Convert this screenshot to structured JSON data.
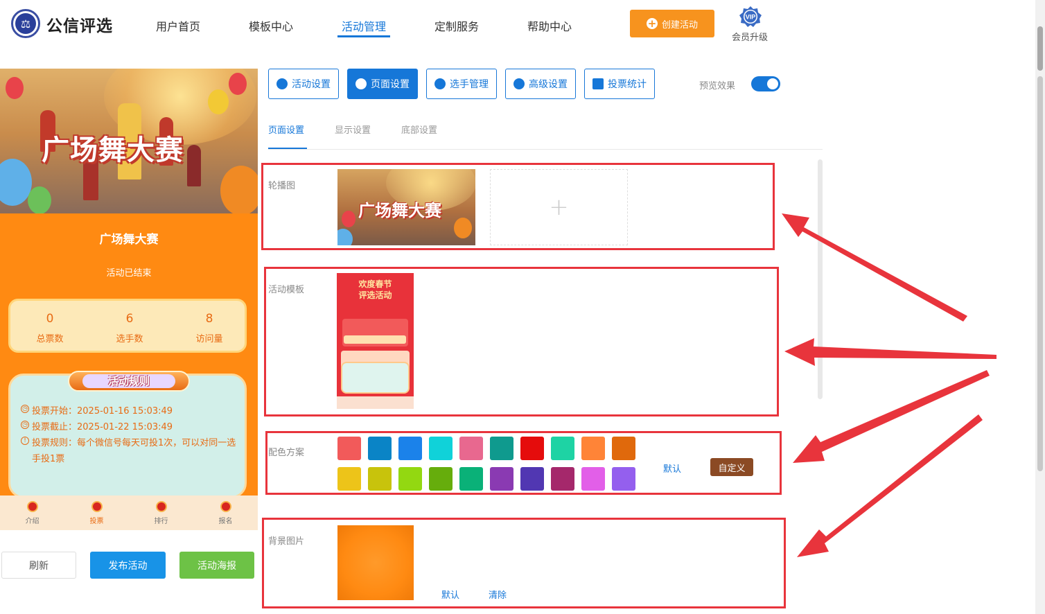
{
  "header": {
    "logo_text": "公信评选",
    "nav": [
      "用户首页",
      "模板中心",
      "活动管理",
      "定制服务",
      "帮助中心"
    ],
    "active_nav": "活动管理",
    "create_label": "创建活动",
    "vip_badge": "VIP",
    "vip_label": "会员升级"
  },
  "preview": {
    "banner_title": "广场舞大赛",
    "title": "广场舞大赛",
    "status": "活动已结束",
    "stats": [
      {
        "value": "0",
        "label": "总票数"
      },
      {
        "value": "6",
        "label": "选手数"
      },
      {
        "value": "8",
        "label": "访问量"
      }
    ],
    "rules_title": "活动规则",
    "rules": [
      "投票开始：2025-01-16 15:03:49",
      "投票截止：2025-01-22 15:03:49",
      "投票规则：每个微信号每天可投1次，可以对同一选手投1票"
    ],
    "bottom_nav": [
      "介绍",
      "投票",
      "排行",
      "报名"
    ],
    "active_bottom": "投票"
  },
  "actions": {
    "refresh": "刷新",
    "publish": "发布活动",
    "poster": "活动海报"
  },
  "toolbar": {
    "buttons": [
      "活动设置",
      "页面设置",
      "选手管理",
      "高级设置",
      "投票统计"
    ],
    "active": "页面设置",
    "preview_label": "预览效果",
    "preview_on": true
  },
  "sub_tabs": [
    "页面设置",
    "显示设置",
    "底部设置"
  ],
  "sections": {
    "carousel_label": "轮播图",
    "carousel_image_title": "广场舞大赛",
    "upload_plus": "+",
    "template_label": "活动模板",
    "template_image_title": "欢度春节\n评选活动",
    "color_label": "配色方案",
    "color_default": "默认",
    "color_custom": "自定义",
    "bg_label": "背景图片",
    "bg_default": "默认",
    "bg_clear": "清除"
  },
  "palette": [
    "#f25a5a",
    "#0a84c6",
    "#1b82ea",
    "#10d2d9",
    "#e8688f",
    "#0f9a8e",
    "#e50c0c",
    "#1ed3a4",
    "#ff8437",
    "#e0690c",
    "#edc419",
    "#c8c30c",
    "#93d811",
    "#66ad0c",
    "#0ab178",
    "#8a3ab2",
    "#5137b2",
    "#a5286b",
    "#e25fe8",
    "#945fee"
  ],
  "colors": {
    "primary": "#1677d8",
    "accent": "#f7931e",
    "highlight": "#e8343c",
    "publish": "#1893e7",
    "poster": "#6dc246"
  }
}
